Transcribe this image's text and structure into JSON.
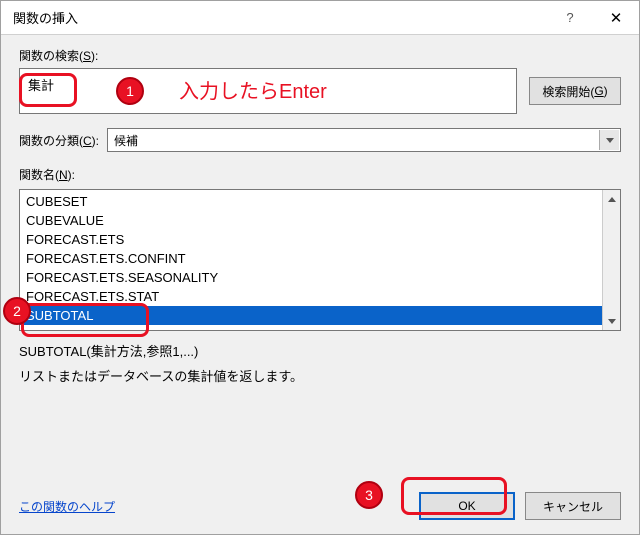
{
  "titlebar": {
    "title": "関数の挿入"
  },
  "search": {
    "label": "関数の検索(S):",
    "value": "集計",
    "go_button": "検索開始(G)"
  },
  "category": {
    "label": "関数の分類(C):",
    "value": "候補"
  },
  "namelist": {
    "label": "関数名(N):"
  },
  "functions": [
    "CUBESET",
    "CUBEVALUE",
    "FORECAST.ETS",
    "FORECAST.ETS.CONFINT",
    "FORECAST.ETS.SEASONALITY",
    "FORECAST.ETS.STAT",
    "SUBTOTAL"
  ],
  "selected_index": 6,
  "syntax": "SUBTOTAL(集計方法,参照1,...)",
  "description": "リストまたはデータベースの集計値を返します。",
  "footer": {
    "help": "この関数のヘルプ",
    "ok": "OK",
    "cancel": "キャンセル"
  },
  "annotations": {
    "badge1": "1",
    "badge2": "2",
    "badge3": "3",
    "hint": "入力したらEnter"
  }
}
